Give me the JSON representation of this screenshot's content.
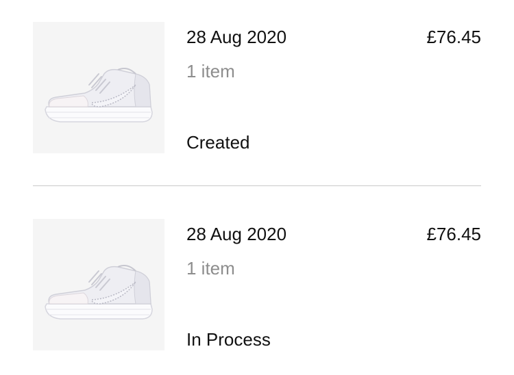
{
  "orders": [
    {
      "date": "28 Aug 2020",
      "price": "£76.45",
      "item_count": "1 item",
      "status": "Created",
      "thumbnail_icon": "sneaker-icon"
    },
    {
      "date": "28 Aug 2020",
      "price": "£76.45",
      "item_count": "1 item",
      "status": "In Process",
      "thumbnail_icon": "sneaker-icon"
    }
  ],
  "colors": {
    "text_primary": "#111111",
    "text_secondary": "#8d8d8d",
    "thumbnail_background": "#f5f5f5",
    "divider": "#c8c8c8"
  }
}
